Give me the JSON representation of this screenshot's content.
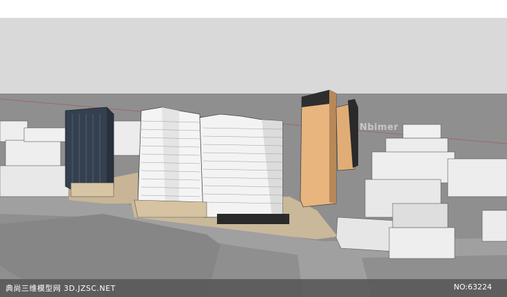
{
  "watermark_partial": "Nbimer",
  "footer": {
    "brand": "典尚三维模型网 3D.JZSC.NET",
    "code": "NO:63224"
  },
  "colors": {
    "sky": "#d8d8d8",
    "ground": "#8c8c8c",
    "road": "#9a9a9a",
    "building_white": "#f2f2f2",
    "tower_orange": "#e9b67f",
    "glass_dark": "#2f3a48"
  }
}
